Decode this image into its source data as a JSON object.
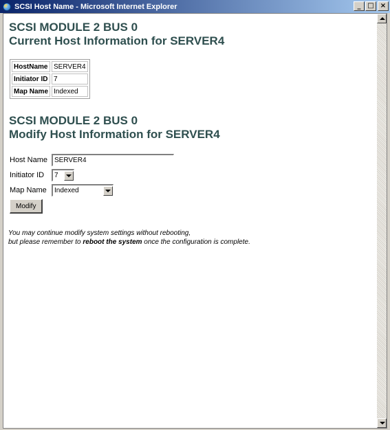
{
  "window": {
    "title": "SCSI Host Name - Microsoft Internet Explorer",
    "buttons": {
      "minimize": "_",
      "maximize": "□",
      "close": "×"
    }
  },
  "current": {
    "heading_line1": "SCSI MODULE 2 BUS 0",
    "heading_line2": "Current Host Information for SERVER4",
    "rows": [
      {
        "key": "HostName",
        "value": "SERVER4"
      },
      {
        "key": "Initiator ID",
        "value": "7"
      },
      {
        "key": "Map Name",
        "value": "Indexed"
      }
    ]
  },
  "modify": {
    "heading_line1": "SCSI MODULE 2 BUS 0",
    "heading_line2": "Modify Host Information for SERVER4",
    "host_name_label": "Host Name",
    "host_name_value": "SERVER4",
    "initiator_label": "Initiator ID",
    "initiator_value": "7",
    "map_label": "Map Name",
    "map_value": "Indexed",
    "button_label": "Modify"
  },
  "note": {
    "line1": "You may continue modify system settings without rebooting,",
    "line2_pre": "but please remember to ",
    "line2_bold": "reboot the system",
    "line2_post": " once the configuration is complete."
  },
  "icons": {
    "app": "ie-icon",
    "scroll_up": "scroll-up-icon",
    "scroll_down": "scroll-down-icon"
  }
}
